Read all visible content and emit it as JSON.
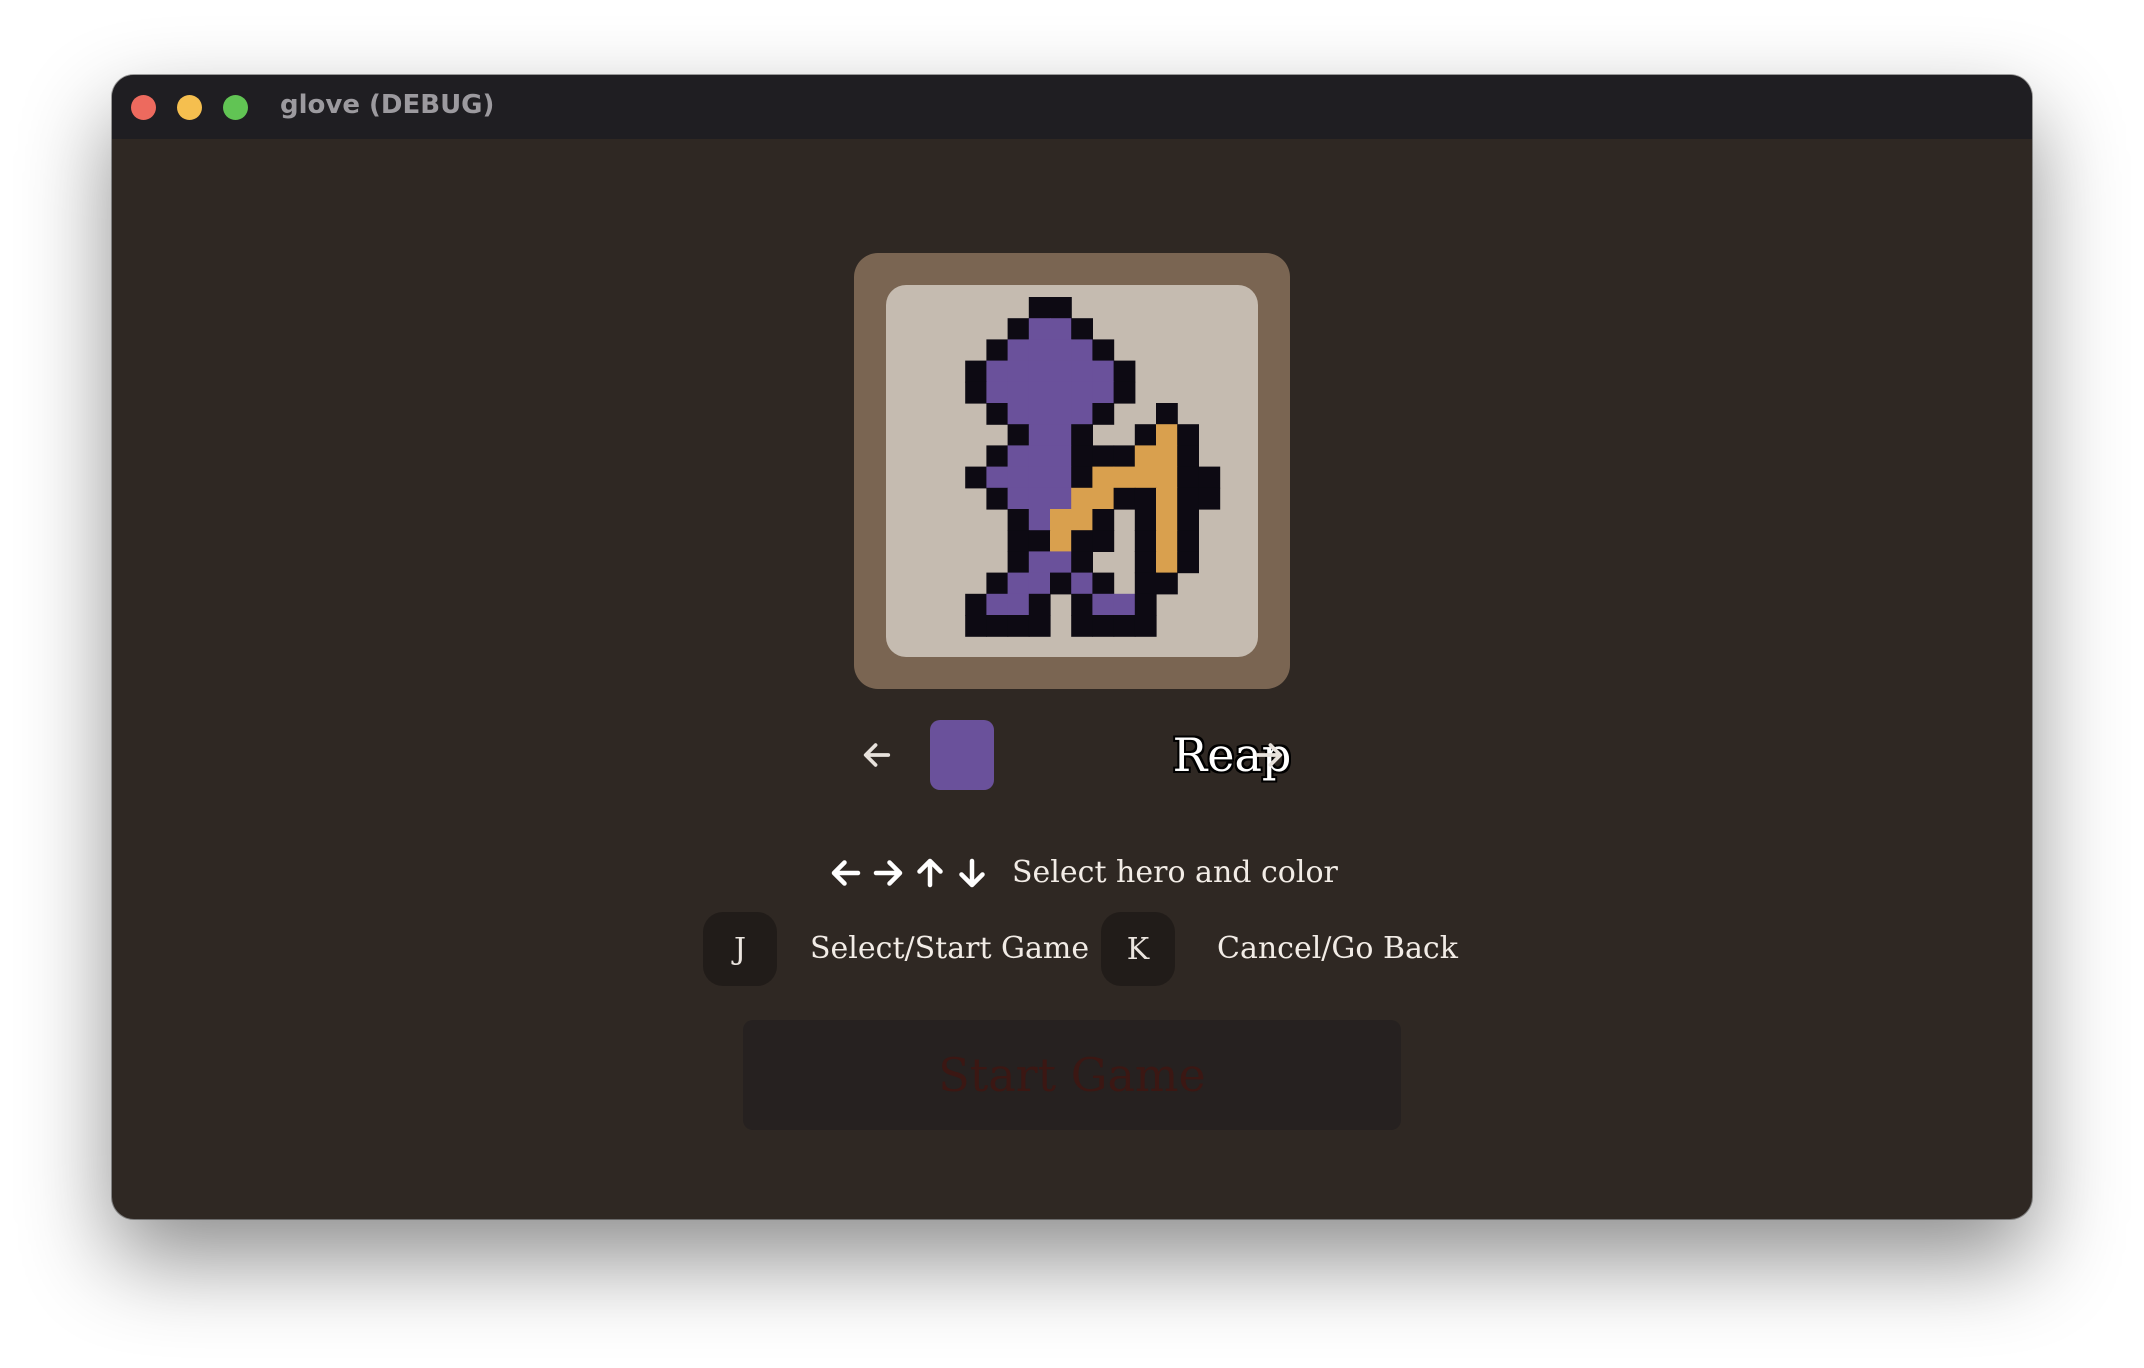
{
  "window": {
    "title": "glove (DEBUG)"
  },
  "hero": {
    "name": "Reap",
    "color": "#6a519b",
    "outline_color": "#0d0a13",
    "accent_color": "#d9a04e",
    "icon": "reaper-with-axe-sprite"
  },
  "controls": {
    "prev_icon": "arrow-left-icon",
    "next_icon": "arrow-right-icon",
    "navigation_hint_icons": [
      "arrow-left-icon",
      "arrow-right-icon",
      "arrow-up-icon",
      "arrow-down-icon"
    ],
    "navigation_hint": "Select hero and color",
    "select_key": "J",
    "select_label": "Select/Start Game",
    "cancel_key": "K",
    "cancel_label": "Cancel/Go Back"
  },
  "start_button": {
    "label": "Start Game",
    "enabled": false
  },
  "colors": {
    "background": "#2f2823",
    "frame": "#7a6552",
    "portrait_bg": "#c5bbb0",
    "titlebar": "#1f1e22"
  }
}
